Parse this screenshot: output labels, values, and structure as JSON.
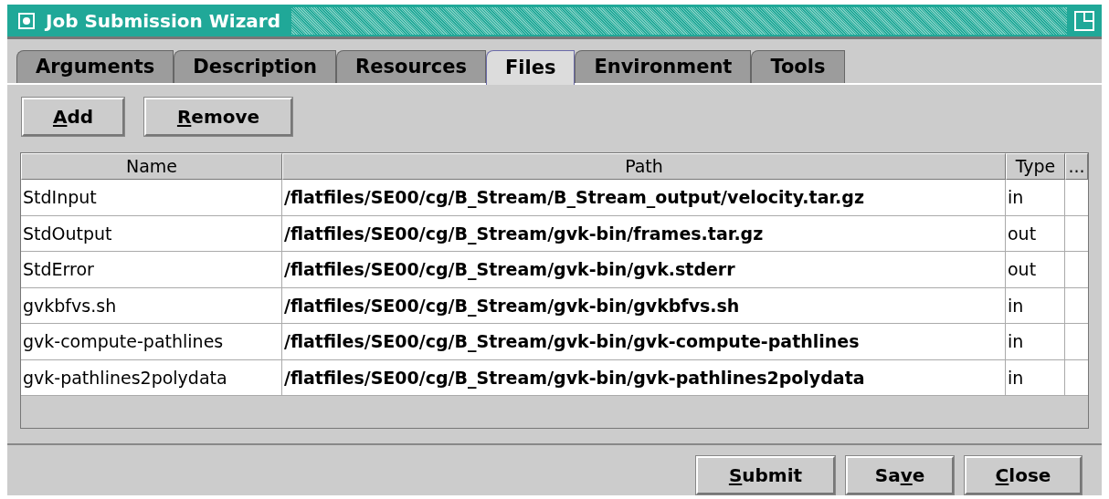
{
  "window": {
    "title": "Job Submission Wizard"
  },
  "tabs": [
    {
      "label": "Arguments",
      "selected": false
    },
    {
      "label": "Description",
      "selected": false
    },
    {
      "label": "Resources",
      "selected": false
    },
    {
      "label": "Files",
      "selected": true
    },
    {
      "label": "Environment",
      "selected": false
    },
    {
      "label": "Tools",
      "selected": false
    }
  ],
  "toolbar": [
    {
      "key": "A",
      "post": "dd"
    },
    {
      "key": "R",
      "post": "emove"
    }
  ],
  "table": {
    "columns": [
      "Name",
      "Path",
      "Type",
      "..."
    ],
    "rows": [
      {
        "name": "StdInput",
        "path": "/flatfiles/SE00/cg/B_Stream/B_Stream_output/velocity.tar.gz",
        "type": "in"
      },
      {
        "name": "StdOutput",
        "path": "/flatfiles/SE00/cg/B_Stream/gvk-bin/frames.tar.gz",
        "type": "out"
      },
      {
        "name": "StdError",
        "path": "/flatfiles/SE00/cg/B_Stream/gvk-bin/gvk.stderr",
        "type": "out"
      },
      {
        "name": "gvkbfvs.sh",
        "path": "/flatfiles/SE00/cg/B_Stream/gvk-bin/gvkbfvs.sh",
        "type": "in"
      },
      {
        "name": "gvk-compute-pathlines",
        "path": "/flatfiles/SE00/cg/B_Stream/gvk-bin/gvk-compute-pathlines",
        "type": "in"
      },
      {
        "name": "gvk-pathlines2polydata",
        "path": "/flatfiles/SE00/cg/B_Stream/gvk-bin/gvk-pathlines2polydata",
        "type": "in"
      }
    ]
  },
  "buttons": [
    {
      "key": "S",
      "post": "ubmit"
    },
    {
      "pre": "Sa",
      "key": "v",
      "post": "e"
    },
    {
      "key": "C",
      "post": "lose"
    }
  ]
}
